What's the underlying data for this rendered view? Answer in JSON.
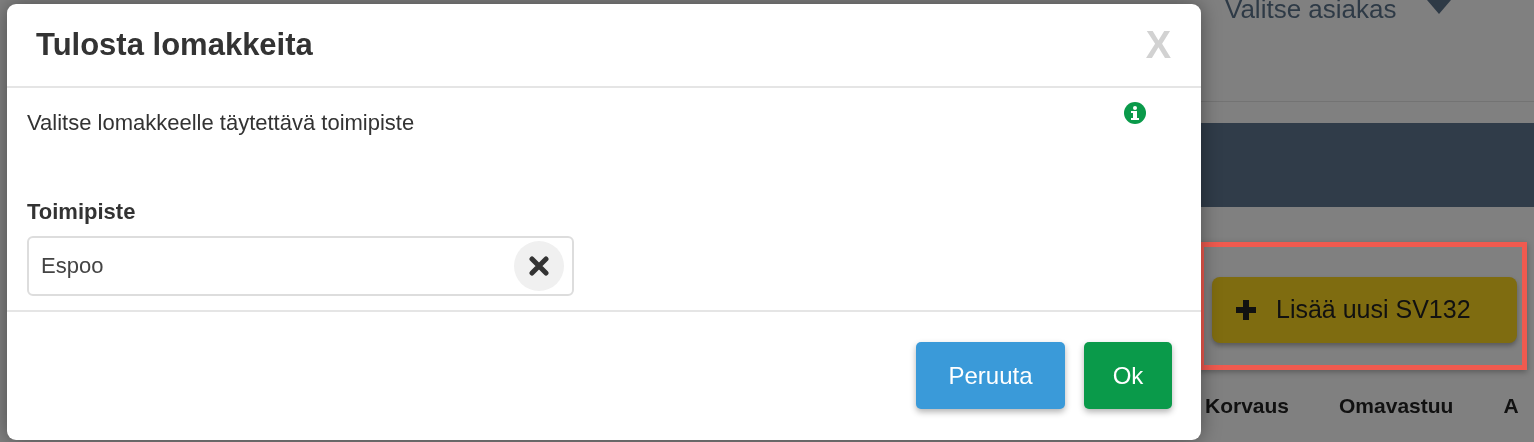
{
  "background": {
    "customer_select": {
      "placeholder": "Valitse asiakas"
    },
    "add_button": {
      "label": "Lisää uusi SV132",
      "highlighted": true
    },
    "table_columns": [
      "Korvaus",
      "Omavastuu",
      "A"
    ]
  },
  "modal": {
    "title": "Tulosta lomakkeita",
    "close": "X",
    "instruction": "Valitse lomakkeelle täytettävä toimipiste",
    "field": {
      "label": "Toimipiste",
      "value": "Espoo"
    },
    "buttons": [
      {
        "label": "Peruuta",
        "kind": "secondary"
      },
      {
        "label": "Ok",
        "kind": "primary"
      }
    ]
  }
}
